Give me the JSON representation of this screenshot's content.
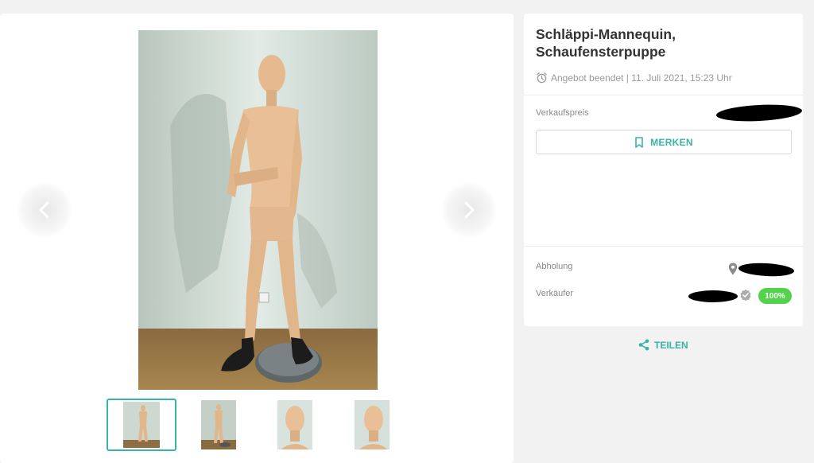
{
  "listing": {
    "title": "Schläppi-Mannequin, Schaufensterpuppe",
    "status": "Angebot beendet | 11. Juli 2021, 15:23 Uhr",
    "price_label": "Verkaufspreis",
    "merken_label": "MERKEN",
    "pickup_label": "Abholung",
    "seller_label": "Verkäufer",
    "seller_rating": "100%",
    "share_label": "TEILEN"
  },
  "icons": {
    "prev": "chevron-left-icon",
    "next": "chevron-right-icon",
    "clock": "alarm-clock-icon",
    "bookmark": "bookmark-icon",
    "location": "map-pin-icon",
    "verified": "verified-badge-icon",
    "share": "share-icon"
  },
  "colors": {
    "accent": "#38b3a6",
    "rating_badge": "#52d34b"
  }
}
